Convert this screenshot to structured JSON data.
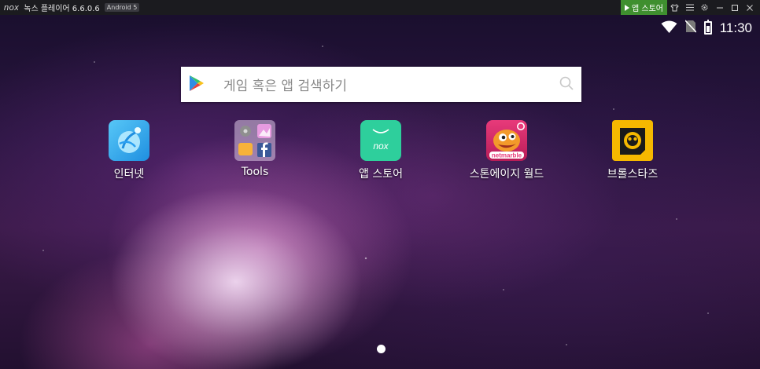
{
  "titlebar": {
    "logo": "nox",
    "title": "녹스 플레이어 6.6.0.6",
    "android_badge": "Android 5",
    "appstore_button": "앱 스토어",
    "icons": [
      "shirt-icon",
      "menu-icon",
      "gear-icon",
      "minimize-icon",
      "maximize-icon",
      "close-icon"
    ]
  },
  "statusbar": {
    "time": "11:30",
    "icons": [
      "wifi-icon",
      "no-sim-icon",
      "battery-icon"
    ]
  },
  "search": {
    "placeholder": "게임 혹은 앱 검색하기"
  },
  "apps": [
    {
      "label": "인터넷",
      "icon": "browser-icon"
    },
    {
      "label": "Tools",
      "icon": "tools-folder-icon"
    },
    {
      "label": "앱 스토어",
      "icon": "nox-store-icon"
    },
    {
      "label": "스톤에이지 월드",
      "icon": "stone-age-icon",
      "badge": "netmarble"
    },
    {
      "label": "브롤스타즈",
      "icon": "brawl-stars-icon"
    }
  ],
  "colors": {
    "titlebar_bg": "#1b1b1f",
    "appstore_green": "#3f8f2f",
    "nox_store_teal": "#2ecf9c",
    "browser_blue": "#3fb0f0",
    "brawl_yellow": "#f5b800"
  }
}
